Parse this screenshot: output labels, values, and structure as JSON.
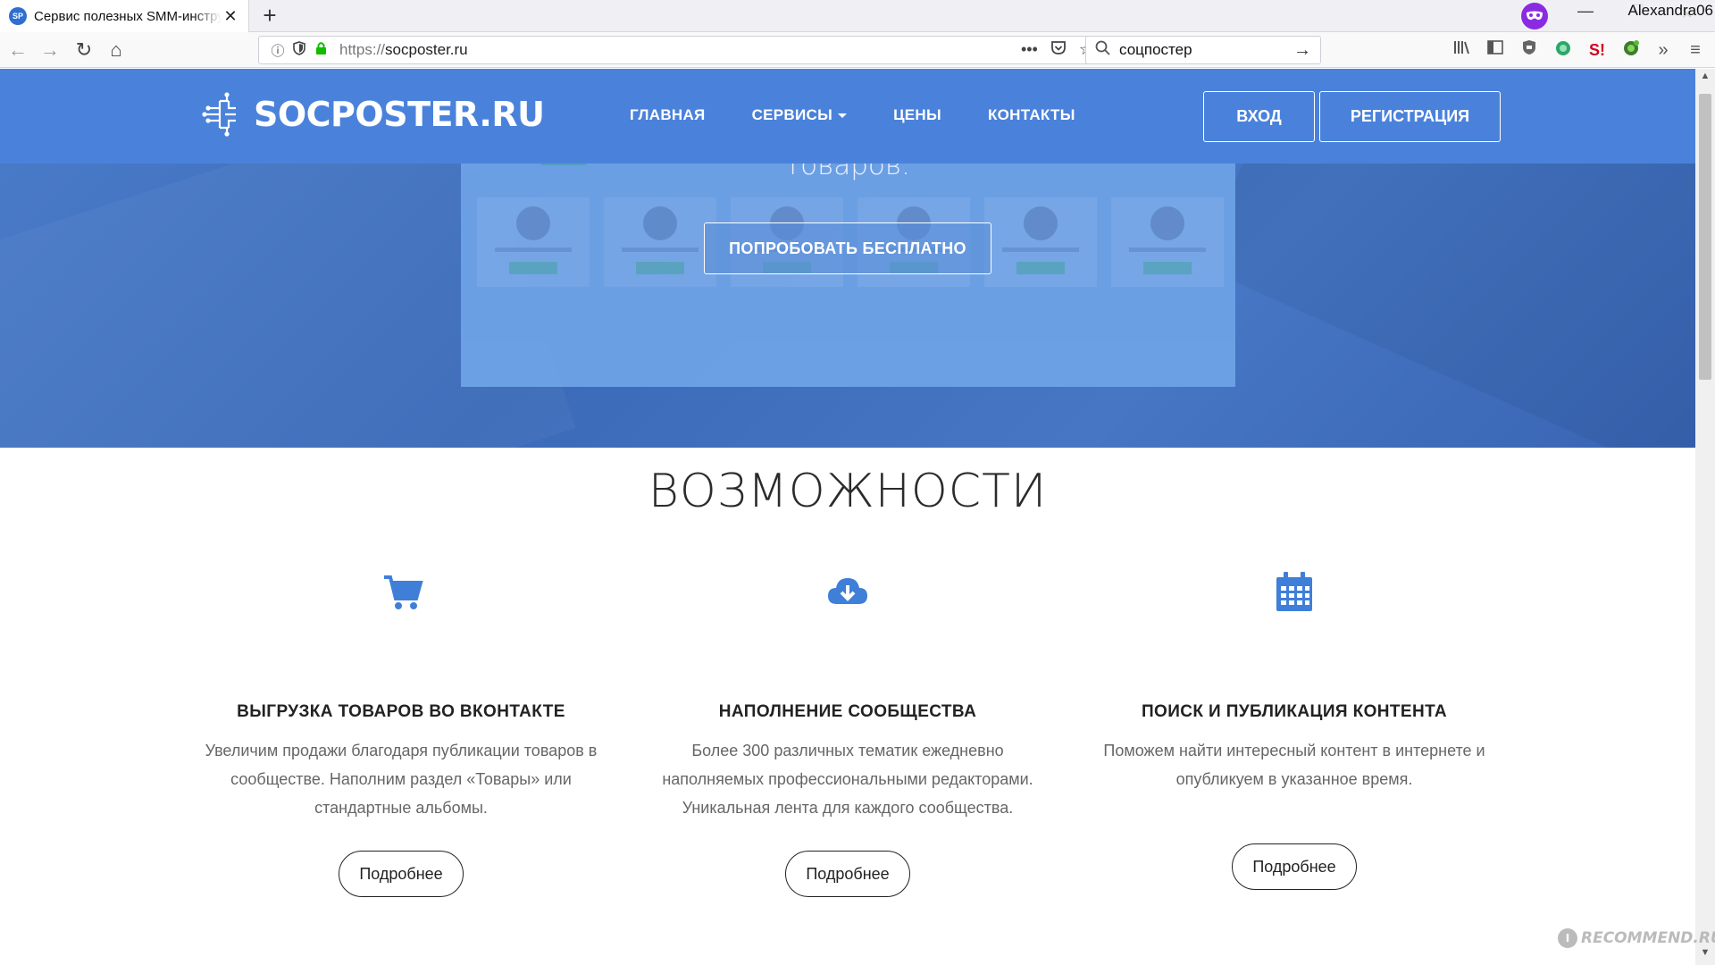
{
  "browser": {
    "tab_title": "Сервис полезных SMM-инструментов",
    "tab_favicon": "SP",
    "tab_close": "✕",
    "newtab_label": "+",
    "user_name": "Alexandra06",
    "url_protocol": "https://",
    "url_host": "socposter.ru",
    "page_actions": "•••",
    "search_query": "соцпостер",
    "icons": [
      "back-icon",
      "forward-icon",
      "reload-icon",
      "home-icon",
      "info-icon",
      "tracking-shield-icon",
      "lock-icon",
      "pocket-icon",
      "bookmark-star-icon",
      "search-icon",
      "library-icon",
      "sidebar-icon",
      "extension-icon",
      "menu-icon"
    ]
  },
  "site": {
    "logo_text": "SOCPOSTER.RU",
    "menu": {
      "home": "ГЛАВНАЯ",
      "services": "СЕРВИСЫ",
      "prices": "ЦЕНЫ",
      "contacts": "КОНТАКТЫ"
    },
    "login_label": "ВХОД",
    "register_label": "РЕГИСТРАЦИЯ",
    "accent_color": "#4a82db"
  },
  "hero": {
    "subtitle_tail": "товаров.",
    "try_button_label": "ПОПРОБОВАТЬ БЕСПЛАТНО"
  },
  "features": {
    "title": "ВОЗМОЖНОСТИ",
    "items": [
      {
        "icon": "shopping-cart-icon",
        "title": "ВЫГРУЗКА ТОВАРОВ ВО ВКОНТАКТЕ",
        "description": "Увеличим продажи благодаря публикации товаров в сообществе. Наполним раздел «Товары» или стандартные альбомы.",
        "button_label": "Подробнее"
      },
      {
        "icon": "cloud-download-icon",
        "title": "НАПОЛНЕНИЕ СООБЩЕСТВА",
        "description": "Более 300 различных тематик ежедневно наполняемых профессиональными редакторами. Уникальная лента для каждого сообщества.",
        "button_label": "Подробнее"
      },
      {
        "icon": "calendar-icon",
        "title": "ПОИСК И ПУБЛИКАЦИЯ КОНТЕНТА",
        "description": "Поможем найти интересный контент в интернете и опубликуем в указанное время.",
        "button_label": "Подробнее"
      }
    ]
  },
  "watermark": {
    "text": "RECOMMEND.RU",
    "badge": "I"
  }
}
